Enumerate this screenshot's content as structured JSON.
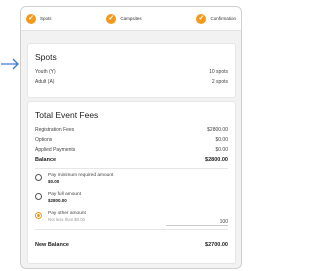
{
  "steps": [
    {
      "label": "Spots"
    },
    {
      "label": "Campsites"
    },
    {
      "label": "Confirmation"
    }
  ],
  "spots": {
    "title": "Spots",
    "rows": [
      {
        "label": "Youth (Y)",
        "value": "10 spots"
      },
      {
        "label": "Adult (A)",
        "value": "2 spots"
      }
    ]
  },
  "fees": {
    "title": "Total Event Fees",
    "rows": [
      {
        "label": "Registration Fees",
        "value": "$2800.00"
      },
      {
        "label": "Options",
        "value": "$0.00"
      },
      {
        "label": "Applied Payments",
        "value": "$0.00"
      }
    ],
    "balance": {
      "label": "Balance",
      "value": "$2800.00"
    },
    "options": [
      {
        "label": "Pay minimum required amount",
        "amount": "$0.00"
      },
      {
        "label": "Pay full amount",
        "amount": "$2800.00"
      },
      {
        "label": "Pay other amount",
        "hint": "Not less than $0.00",
        "input_value": "100"
      }
    ],
    "new_balance": {
      "label": "New Balance",
      "value": "$2700.00"
    }
  },
  "colors": {
    "accent": "#f29a1d"
  }
}
